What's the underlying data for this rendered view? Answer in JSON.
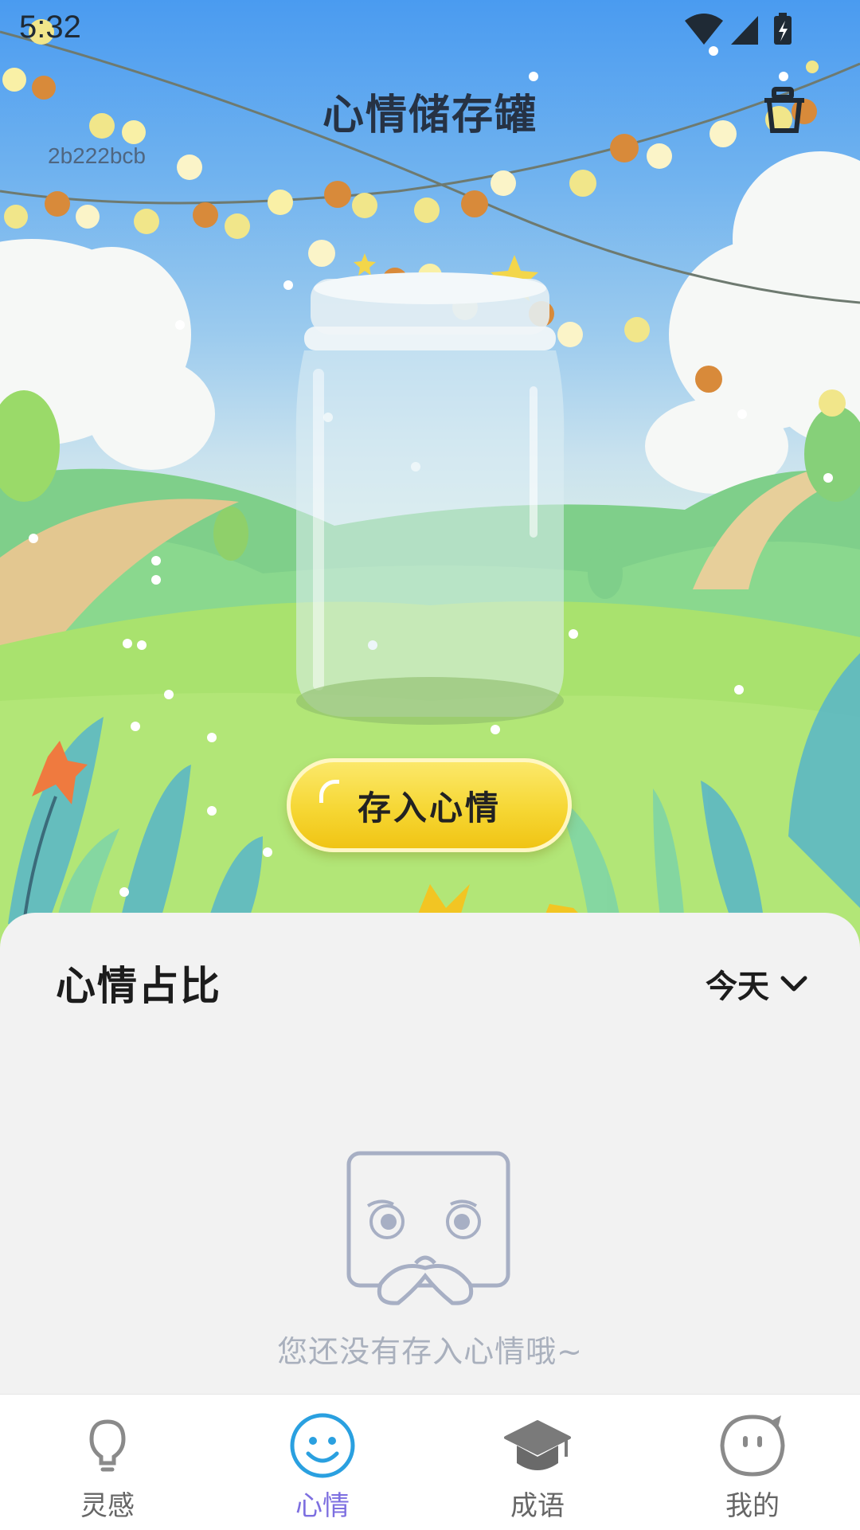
{
  "status_bar": {
    "time": "5:32"
  },
  "header": {
    "title": "心情储存罐",
    "user_id": "2b222bcb"
  },
  "jar": {
    "store_button_label": "存入心情"
  },
  "mood_panel": {
    "title": "心情占比",
    "range_selected": "今天",
    "empty_text": "您还没有存入心情哦~"
  },
  "tabs": [
    {
      "label": "灵感",
      "icon": "lightbulb-icon",
      "active": false
    },
    {
      "label": "心情",
      "icon": "smiley-icon",
      "active": true
    },
    {
      "label": "成语",
      "icon": "graduation-cap-icon",
      "active": false
    },
    {
      "label": "我的",
      "icon": "face-bubble-icon",
      "active": false
    }
  ],
  "colors": {
    "accent": "#7d6fe0",
    "active_icon": "#2aa0e0",
    "button": "#f6d734"
  }
}
